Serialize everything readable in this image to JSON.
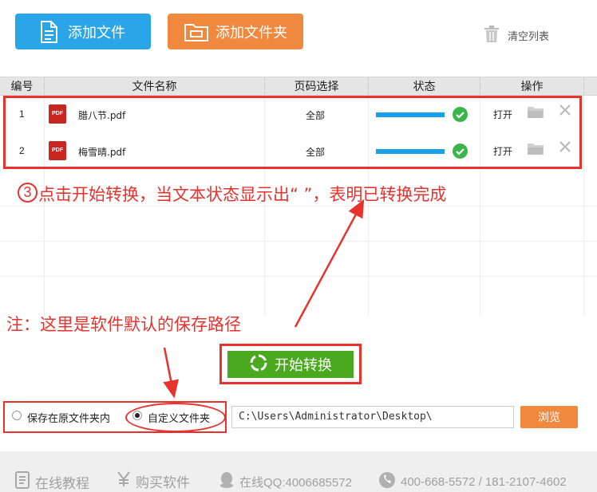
{
  "toolbar": {
    "add_file_label": "添加文件",
    "add_folder_label": "添加文件夹",
    "clear_list_label": "清空列表"
  },
  "table": {
    "headers": [
      "编号",
      "文件名称",
      "页码选择",
      "状态",
      "操作"
    ],
    "rows": [
      {
        "num": "1",
        "filename": "腊八节.pdf",
        "pages": "全部",
        "progress": 1.0,
        "open_label": "打开"
      },
      {
        "num": "2",
        "filename": "梅雪晴.pdf",
        "pages": "全部",
        "progress": 1.0,
        "open_label": "打开"
      }
    ],
    "pdf_icon_text": "PDF"
  },
  "annotations": {
    "step_number": "3",
    "step_text": "点击开始转换，当文本状态显示出“ ”，表明已转换完成",
    "note_text": "注：这里是软件默认的保存路径",
    "color": "#e8322e"
  },
  "convert": {
    "start_label": "开始转换"
  },
  "save": {
    "option_original": "保存在原文件夹内",
    "option_custom": "自定义文件夹",
    "selected": "custom",
    "path_value": "C:\\Users\\Administrator\\Desktop\\",
    "browse_label": "浏览"
  },
  "footer": {
    "tutorial_label": "在线教程",
    "buy_label": "购买软件",
    "qq_label": "在线QQ:4006685572",
    "phone_label": "400-668-5572 / 181-2107-4602"
  },
  "colors": {
    "blue": "#2aa6e8",
    "orange": "#f0883e",
    "green": "#4aa91e",
    "check_green": "#3ab54a",
    "annotation_red": "#e8322e"
  },
  "icons": {
    "add_file": "document-icon",
    "add_folder": "folder-icon",
    "clear": "trash-icon",
    "status": "check-circle-icon",
    "open_folder": "folder-open-icon",
    "delete": "close-icon",
    "start": "refresh-icon",
    "tutorial": "book-icon",
    "buy": "yen-icon",
    "qq": "qq-icon",
    "phone": "phone-icon"
  }
}
